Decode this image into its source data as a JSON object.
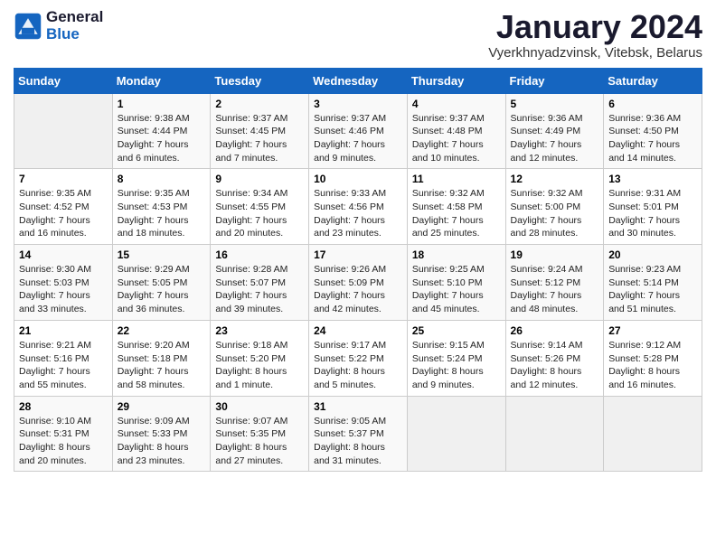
{
  "header": {
    "logo_line1": "General",
    "logo_line2": "Blue",
    "month_title": "January 2024",
    "location": "Vyerkhnyadzvinsk, Vitebsk, Belarus"
  },
  "weekdays": [
    "Sunday",
    "Monday",
    "Tuesday",
    "Wednesday",
    "Thursday",
    "Friday",
    "Saturday"
  ],
  "weeks": [
    [
      {
        "day": "",
        "sunrise": "",
        "sunset": "",
        "daylight": ""
      },
      {
        "day": "1",
        "sunrise": "Sunrise: 9:38 AM",
        "sunset": "Sunset: 4:44 PM",
        "daylight": "Daylight: 7 hours and 6 minutes."
      },
      {
        "day": "2",
        "sunrise": "Sunrise: 9:37 AM",
        "sunset": "Sunset: 4:45 PM",
        "daylight": "Daylight: 7 hours and 7 minutes."
      },
      {
        "day": "3",
        "sunrise": "Sunrise: 9:37 AM",
        "sunset": "Sunset: 4:46 PM",
        "daylight": "Daylight: 7 hours and 9 minutes."
      },
      {
        "day": "4",
        "sunrise": "Sunrise: 9:37 AM",
        "sunset": "Sunset: 4:48 PM",
        "daylight": "Daylight: 7 hours and 10 minutes."
      },
      {
        "day": "5",
        "sunrise": "Sunrise: 9:36 AM",
        "sunset": "Sunset: 4:49 PM",
        "daylight": "Daylight: 7 hours and 12 minutes."
      },
      {
        "day": "6",
        "sunrise": "Sunrise: 9:36 AM",
        "sunset": "Sunset: 4:50 PM",
        "daylight": "Daylight: 7 hours and 14 minutes."
      }
    ],
    [
      {
        "day": "7",
        "sunrise": "Sunrise: 9:35 AM",
        "sunset": "Sunset: 4:52 PM",
        "daylight": "Daylight: 7 hours and 16 minutes."
      },
      {
        "day": "8",
        "sunrise": "Sunrise: 9:35 AM",
        "sunset": "Sunset: 4:53 PM",
        "daylight": "Daylight: 7 hours and 18 minutes."
      },
      {
        "day": "9",
        "sunrise": "Sunrise: 9:34 AM",
        "sunset": "Sunset: 4:55 PM",
        "daylight": "Daylight: 7 hours and 20 minutes."
      },
      {
        "day": "10",
        "sunrise": "Sunrise: 9:33 AM",
        "sunset": "Sunset: 4:56 PM",
        "daylight": "Daylight: 7 hours and 23 minutes."
      },
      {
        "day": "11",
        "sunrise": "Sunrise: 9:32 AM",
        "sunset": "Sunset: 4:58 PM",
        "daylight": "Daylight: 7 hours and 25 minutes."
      },
      {
        "day": "12",
        "sunrise": "Sunrise: 9:32 AM",
        "sunset": "Sunset: 5:00 PM",
        "daylight": "Daylight: 7 hours and 28 minutes."
      },
      {
        "day": "13",
        "sunrise": "Sunrise: 9:31 AM",
        "sunset": "Sunset: 5:01 PM",
        "daylight": "Daylight: 7 hours and 30 minutes."
      }
    ],
    [
      {
        "day": "14",
        "sunrise": "Sunrise: 9:30 AM",
        "sunset": "Sunset: 5:03 PM",
        "daylight": "Daylight: 7 hours and 33 minutes."
      },
      {
        "day": "15",
        "sunrise": "Sunrise: 9:29 AM",
        "sunset": "Sunset: 5:05 PM",
        "daylight": "Daylight: 7 hours and 36 minutes."
      },
      {
        "day": "16",
        "sunrise": "Sunrise: 9:28 AM",
        "sunset": "Sunset: 5:07 PM",
        "daylight": "Daylight: 7 hours and 39 minutes."
      },
      {
        "day": "17",
        "sunrise": "Sunrise: 9:26 AM",
        "sunset": "Sunset: 5:09 PM",
        "daylight": "Daylight: 7 hours and 42 minutes."
      },
      {
        "day": "18",
        "sunrise": "Sunrise: 9:25 AM",
        "sunset": "Sunset: 5:10 PM",
        "daylight": "Daylight: 7 hours and 45 minutes."
      },
      {
        "day": "19",
        "sunrise": "Sunrise: 9:24 AM",
        "sunset": "Sunset: 5:12 PM",
        "daylight": "Daylight: 7 hours and 48 minutes."
      },
      {
        "day": "20",
        "sunrise": "Sunrise: 9:23 AM",
        "sunset": "Sunset: 5:14 PM",
        "daylight": "Daylight: 7 hours and 51 minutes."
      }
    ],
    [
      {
        "day": "21",
        "sunrise": "Sunrise: 9:21 AM",
        "sunset": "Sunset: 5:16 PM",
        "daylight": "Daylight: 7 hours and 55 minutes."
      },
      {
        "day": "22",
        "sunrise": "Sunrise: 9:20 AM",
        "sunset": "Sunset: 5:18 PM",
        "daylight": "Daylight: 7 hours and 58 minutes."
      },
      {
        "day": "23",
        "sunrise": "Sunrise: 9:18 AM",
        "sunset": "Sunset: 5:20 PM",
        "daylight": "Daylight: 8 hours and 1 minute."
      },
      {
        "day": "24",
        "sunrise": "Sunrise: 9:17 AM",
        "sunset": "Sunset: 5:22 PM",
        "daylight": "Daylight: 8 hours and 5 minutes."
      },
      {
        "day": "25",
        "sunrise": "Sunrise: 9:15 AM",
        "sunset": "Sunset: 5:24 PM",
        "daylight": "Daylight: 8 hours and 9 minutes."
      },
      {
        "day": "26",
        "sunrise": "Sunrise: 9:14 AM",
        "sunset": "Sunset: 5:26 PM",
        "daylight": "Daylight: 8 hours and 12 minutes."
      },
      {
        "day": "27",
        "sunrise": "Sunrise: 9:12 AM",
        "sunset": "Sunset: 5:28 PM",
        "daylight": "Daylight: 8 hours and 16 minutes."
      }
    ],
    [
      {
        "day": "28",
        "sunrise": "Sunrise: 9:10 AM",
        "sunset": "Sunset: 5:31 PM",
        "daylight": "Daylight: 8 hours and 20 minutes."
      },
      {
        "day": "29",
        "sunrise": "Sunrise: 9:09 AM",
        "sunset": "Sunset: 5:33 PM",
        "daylight": "Daylight: 8 hours and 23 minutes."
      },
      {
        "day": "30",
        "sunrise": "Sunrise: 9:07 AM",
        "sunset": "Sunset: 5:35 PM",
        "daylight": "Daylight: 8 hours and 27 minutes."
      },
      {
        "day": "31",
        "sunrise": "Sunrise: 9:05 AM",
        "sunset": "Sunset: 5:37 PM",
        "daylight": "Daylight: 8 hours and 31 minutes."
      },
      {
        "day": "",
        "sunrise": "",
        "sunset": "",
        "daylight": ""
      },
      {
        "day": "",
        "sunrise": "",
        "sunset": "",
        "daylight": ""
      },
      {
        "day": "",
        "sunrise": "",
        "sunset": "",
        "daylight": ""
      }
    ]
  ]
}
